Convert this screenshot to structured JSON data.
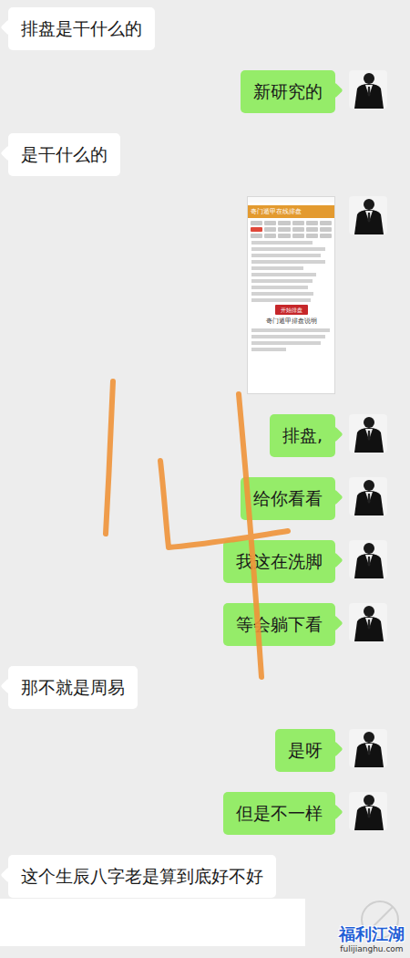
{
  "messages": [
    {
      "side": "left",
      "kind": "text",
      "text": "排盘是干什么的"
    },
    {
      "side": "right",
      "kind": "text",
      "text": "新研究的"
    },
    {
      "side": "left",
      "kind": "text",
      "text": "是干什么的"
    },
    {
      "side": "right",
      "kind": "image",
      "image": {
        "title": "奇门遁甲在线排盘",
        "button": "开始排盘",
        "heading": "奇门遁甲排盘说明"
      }
    },
    {
      "side": "right",
      "kind": "text",
      "text": "排盘,"
    },
    {
      "side": "right",
      "kind": "text",
      "text": "给你看看"
    },
    {
      "side": "right",
      "kind": "text",
      "text": "我这在洗脚"
    },
    {
      "side": "right",
      "kind": "text",
      "text": "等会躺下看"
    },
    {
      "side": "left",
      "kind": "text",
      "text": "那不就是周易"
    },
    {
      "side": "right",
      "kind": "text",
      "text": "是呀"
    },
    {
      "side": "right",
      "kind": "text",
      "text": "但是不一样"
    },
    {
      "side": "left",
      "kind": "text",
      "text": "这个生辰八字老是算到底好不好"
    }
  ],
  "watermark": {
    "name": "福利江湖",
    "url": "fulijianghu.com"
  }
}
